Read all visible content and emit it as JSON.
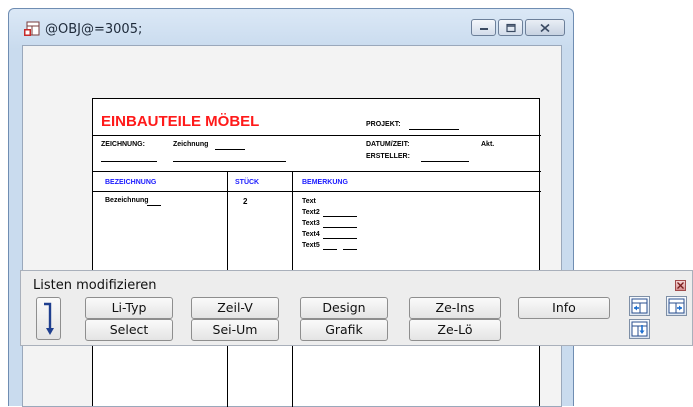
{
  "window": {
    "title": "@OBJ@=3005;"
  },
  "sheet": {
    "title": "EINBAUTEILE MÖBEL",
    "projekt_label": "PROJEKT:",
    "zeichnung_label": "ZEICHNUNG:",
    "zeichnung_value": "Zeichnung",
    "datum_label": "DATUM/ZEIT:",
    "akt_label": "Akt.",
    "ersteller_label": "ERSTELLER:",
    "col_headers": [
      "BEZEICHNUNG",
      "STÜCK",
      "BEMERKUNG"
    ],
    "row": {
      "bezeichnung": "Bezeichnung",
      "stueck": "2",
      "bemerkung": [
        "Text",
        "Text2",
        "Text3",
        "Text4",
        "Text5"
      ]
    },
    "title_color": "#ff1a1a",
    "header_color": "#1a1aff"
  },
  "panel": {
    "title": "Listen modifizieren",
    "buttons_row1": [
      "Li-Typ",
      "Zeil-V",
      "Design",
      "Ze-Ins",
      "Info"
    ],
    "buttons_row2": [
      "Select",
      "Sei-Um",
      "Grafik",
      "Ze-Lö"
    ]
  },
  "icons": {
    "app": "layout-app-icon",
    "minimize": "minimize-icon",
    "maximize": "maximize-icon",
    "close": "close-icon",
    "panel_close": "panel-close-icon",
    "big_arrow": "return-arrow-icon",
    "icon1": "move-left-icon",
    "icon2": "move-right-icon",
    "icon3": "move-down-icon"
  }
}
